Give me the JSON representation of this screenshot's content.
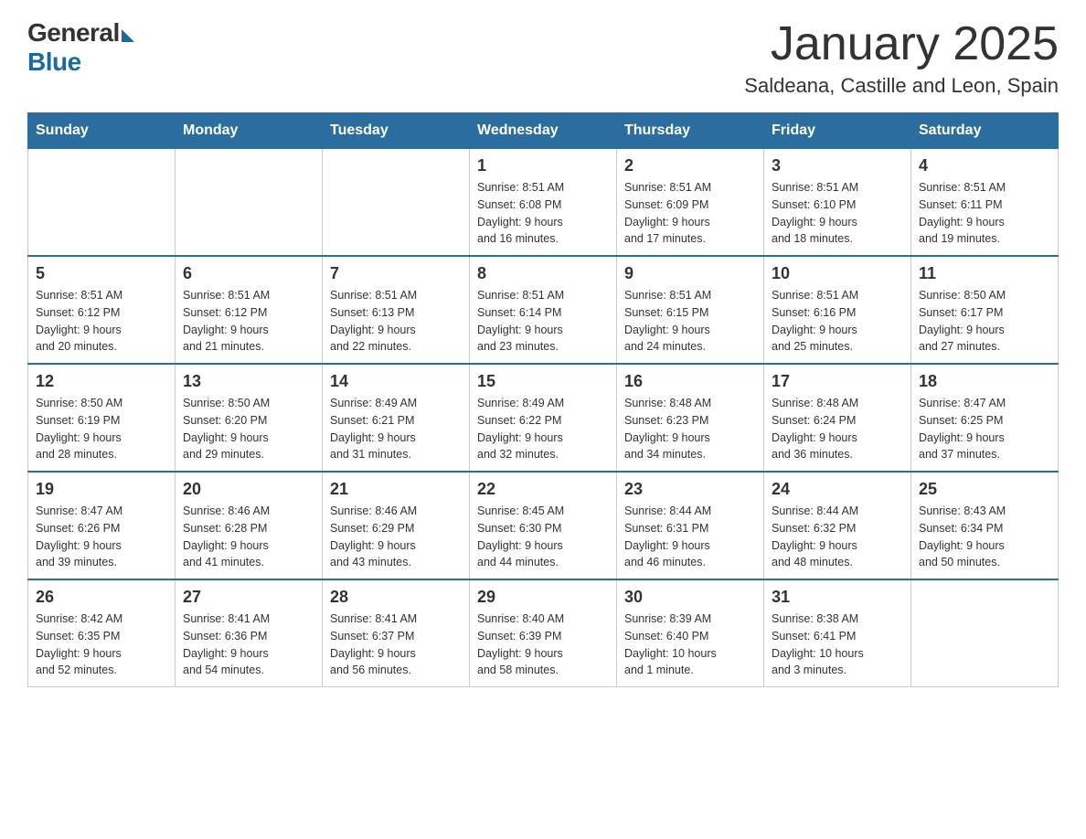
{
  "header": {
    "logo_general": "General",
    "logo_blue": "Blue",
    "month_title": "January 2025",
    "location": "Saldeana, Castille and Leon, Spain"
  },
  "days_of_week": [
    "Sunday",
    "Monday",
    "Tuesday",
    "Wednesday",
    "Thursday",
    "Friday",
    "Saturday"
  ],
  "weeks": [
    [
      {
        "day": "",
        "info": ""
      },
      {
        "day": "",
        "info": ""
      },
      {
        "day": "",
        "info": ""
      },
      {
        "day": "1",
        "info": "Sunrise: 8:51 AM\nSunset: 6:08 PM\nDaylight: 9 hours\nand 16 minutes."
      },
      {
        "day": "2",
        "info": "Sunrise: 8:51 AM\nSunset: 6:09 PM\nDaylight: 9 hours\nand 17 minutes."
      },
      {
        "day": "3",
        "info": "Sunrise: 8:51 AM\nSunset: 6:10 PM\nDaylight: 9 hours\nand 18 minutes."
      },
      {
        "day": "4",
        "info": "Sunrise: 8:51 AM\nSunset: 6:11 PM\nDaylight: 9 hours\nand 19 minutes."
      }
    ],
    [
      {
        "day": "5",
        "info": "Sunrise: 8:51 AM\nSunset: 6:12 PM\nDaylight: 9 hours\nand 20 minutes."
      },
      {
        "day": "6",
        "info": "Sunrise: 8:51 AM\nSunset: 6:12 PM\nDaylight: 9 hours\nand 21 minutes."
      },
      {
        "day": "7",
        "info": "Sunrise: 8:51 AM\nSunset: 6:13 PM\nDaylight: 9 hours\nand 22 minutes."
      },
      {
        "day": "8",
        "info": "Sunrise: 8:51 AM\nSunset: 6:14 PM\nDaylight: 9 hours\nand 23 minutes."
      },
      {
        "day": "9",
        "info": "Sunrise: 8:51 AM\nSunset: 6:15 PM\nDaylight: 9 hours\nand 24 minutes."
      },
      {
        "day": "10",
        "info": "Sunrise: 8:51 AM\nSunset: 6:16 PM\nDaylight: 9 hours\nand 25 minutes."
      },
      {
        "day": "11",
        "info": "Sunrise: 8:50 AM\nSunset: 6:17 PM\nDaylight: 9 hours\nand 27 minutes."
      }
    ],
    [
      {
        "day": "12",
        "info": "Sunrise: 8:50 AM\nSunset: 6:19 PM\nDaylight: 9 hours\nand 28 minutes."
      },
      {
        "day": "13",
        "info": "Sunrise: 8:50 AM\nSunset: 6:20 PM\nDaylight: 9 hours\nand 29 minutes."
      },
      {
        "day": "14",
        "info": "Sunrise: 8:49 AM\nSunset: 6:21 PM\nDaylight: 9 hours\nand 31 minutes."
      },
      {
        "day": "15",
        "info": "Sunrise: 8:49 AM\nSunset: 6:22 PM\nDaylight: 9 hours\nand 32 minutes."
      },
      {
        "day": "16",
        "info": "Sunrise: 8:48 AM\nSunset: 6:23 PM\nDaylight: 9 hours\nand 34 minutes."
      },
      {
        "day": "17",
        "info": "Sunrise: 8:48 AM\nSunset: 6:24 PM\nDaylight: 9 hours\nand 36 minutes."
      },
      {
        "day": "18",
        "info": "Sunrise: 8:47 AM\nSunset: 6:25 PM\nDaylight: 9 hours\nand 37 minutes."
      }
    ],
    [
      {
        "day": "19",
        "info": "Sunrise: 8:47 AM\nSunset: 6:26 PM\nDaylight: 9 hours\nand 39 minutes."
      },
      {
        "day": "20",
        "info": "Sunrise: 8:46 AM\nSunset: 6:28 PM\nDaylight: 9 hours\nand 41 minutes."
      },
      {
        "day": "21",
        "info": "Sunrise: 8:46 AM\nSunset: 6:29 PM\nDaylight: 9 hours\nand 43 minutes."
      },
      {
        "day": "22",
        "info": "Sunrise: 8:45 AM\nSunset: 6:30 PM\nDaylight: 9 hours\nand 44 minutes."
      },
      {
        "day": "23",
        "info": "Sunrise: 8:44 AM\nSunset: 6:31 PM\nDaylight: 9 hours\nand 46 minutes."
      },
      {
        "day": "24",
        "info": "Sunrise: 8:44 AM\nSunset: 6:32 PM\nDaylight: 9 hours\nand 48 minutes."
      },
      {
        "day": "25",
        "info": "Sunrise: 8:43 AM\nSunset: 6:34 PM\nDaylight: 9 hours\nand 50 minutes."
      }
    ],
    [
      {
        "day": "26",
        "info": "Sunrise: 8:42 AM\nSunset: 6:35 PM\nDaylight: 9 hours\nand 52 minutes."
      },
      {
        "day": "27",
        "info": "Sunrise: 8:41 AM\nSunset: 6:36 PM\nDaylight: 9 hours\nand 54 minutes."
      },
      {
        "day": "28",
        "info": "Sunrise: 8:41 AM\nSunset: 6:37 PM\nDaylight: 9 hours\nand 56 minutes."
      },
      {
        "day": "29",
        "info": "Sunrise: 8:40 AM\nSunset: 6:39 PM\nDaylight: 9 hours\nand 58 minutes."
      },
      {
        "day": "30",
        "info": "Sunrise: 8:39 AM\nSunset: 6:40 PM\nDaylight: 10 hours\nand 1 minute."
      },
      {
        "day": "31",
        "info": "Sunrise: 8:38 AM\nSunset: 6:41 PM\nDaylight: 10 hours\nand 3 minutes."
      },
      {
        "day": "",
        "info": ""
      }
    ]
  ]
}
